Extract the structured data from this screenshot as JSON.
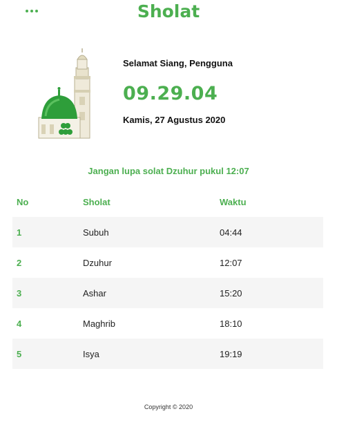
{
  "header": {
    "title": "Sholat",
    "menu_icon": "more-horizontal-icon"
  },
  "hero": {
    "image_icon": "mosque-icon",
    "greeting": "Selamat Siang, Pengguna",
    "time": "09.29.04",
    "date": "Kamis, 27 Agustus 2020"
  },
  "reminder": {
    "prefix": "Jangan lupa solat",
    "prayer": "Dzuhur",
    "middle": "pukul",
    "time": "12:07"
  },
  "table": {
    "headers": [
      "No",
      "Sholat",
      "Waktu"
    ],
    "rows": [
      {
        "no": "1",
        "name": "Subuh",
        "time": "04:44"
      },
      {
        "no": "2",
        "name": "Dzuhur",
        "time": "12:07"
      },
      {
        "no": "3",
        "name": "Ashar",
        "time": "15:20"
      },
      {
        "no": "4",
        "name": "Maghrib",
        "time": "18:10"
      },
      {
        "no": "5",
        "name": "Isya",
        "time": "19:19"
      }
    ]
  },
  "footer": {
    "copyright": "Copyright © 2020"
  },
  "colors": {
    "accent": "#4caf50",
    "row_shade": "#f5f5f5"
  }
}
